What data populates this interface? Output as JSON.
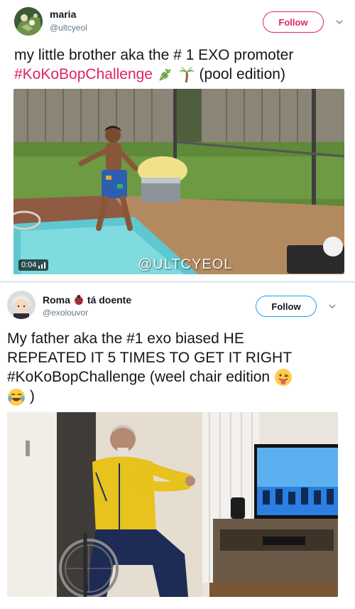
{
  "tweets": [
    {
      "author_name": "maria",
      "author_handle": "@ultcyeol",
      "follow_label": "Follow",
      "text_prefix": "my little brother aka the # 1 EXO promoter",
      "hashtag": "#KoKoBopChallenge",
      "text_suffix": "(pool edition)",
      "emojis": [
        "herb-leaf",
        "palm-tree"
      ],
      "video_time": "0:04",
      "watermark": "@ULTCYEOL",
      "accent_color": "#e0245e"
    },
    {
      "author_name": "Roma",
      "author_name_suffix": "tá doente",
      "author_emoji": "ladybug",
      "author_handle": "@exolouvor",
      "follow_label": "Follow",
      "text_line1": "My father aka the #1 exo biased HE",
      "text_line2": "REPEATED IT 5 TIMES TO GET IT RIGHT",
      "hashtag": "#KoKoBopChallenge",
      "text_suffix": "(weel chair edition",
      "text_closing": ")",
      "emojis": [
        "tongue-out-face",
        "tears-of-joy-face"
      ],
      "accent_color": "#1da1f2"
    }
  ]
}
